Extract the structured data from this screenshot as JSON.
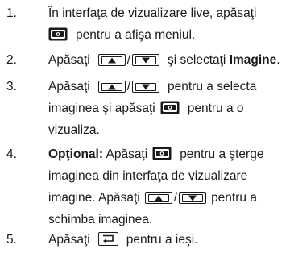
{
  "steps": [
    {
      "number": "1.",
      "lines": {
        "l1": "În interfaţa de vizualizare live, apăsaţi",
        "l2_after_icon": "pentru a afişa meniul."
      }
    },
    {
      "number": "2.",
      "lines": {
        "l1_pre": "Apăsaţi",
        "l1_mid": "şi selectaţi",
        "l1_bold": "Imagine",
        "l1_end": "."
      }
    },
    {
      "number": "3.",
      "lines": {
        "l1_pre": "Apăsaţi",
        "l1_post": "pentru a selecta",
        "l2_pre": "imaginea şi apăsaţi",
        "l2_post": "pentru a o",
        "l3": "vizualiza."
      }
    },
    {
      "number": "4.",
      "lines": {
        "l1_bold": "Opţional:",
        "l1_pre": "Apăsaţi",
        "l1_post": "pentru a şterge",
        "l2": "imaginea din interfaţa de vizualizare",
        "l3_pre": "imagine. Apăsaţi",
        "l3_post": "pentru a",
        "l4": "schimba imaginea."
      }
    },
    {
      "number": "5.",
      "lines": {
        "l1_pre": "Apăsaţi",
        "l1_post": "pentru a ieşi."
      }
    }
  ],
  "icons": {
    "menu": "camera-menu-icon",
    "up": "up-arrow-key-icon",
    "down": "down-arrow-key-icon",
    "back": "back-key-icon",
    "slash": "/"
  },
  "colors": {
    "text": "#1a1a1a",
    "icon_fill": "#1a1a1a",
    "background": "#ffffff"
  }
}
